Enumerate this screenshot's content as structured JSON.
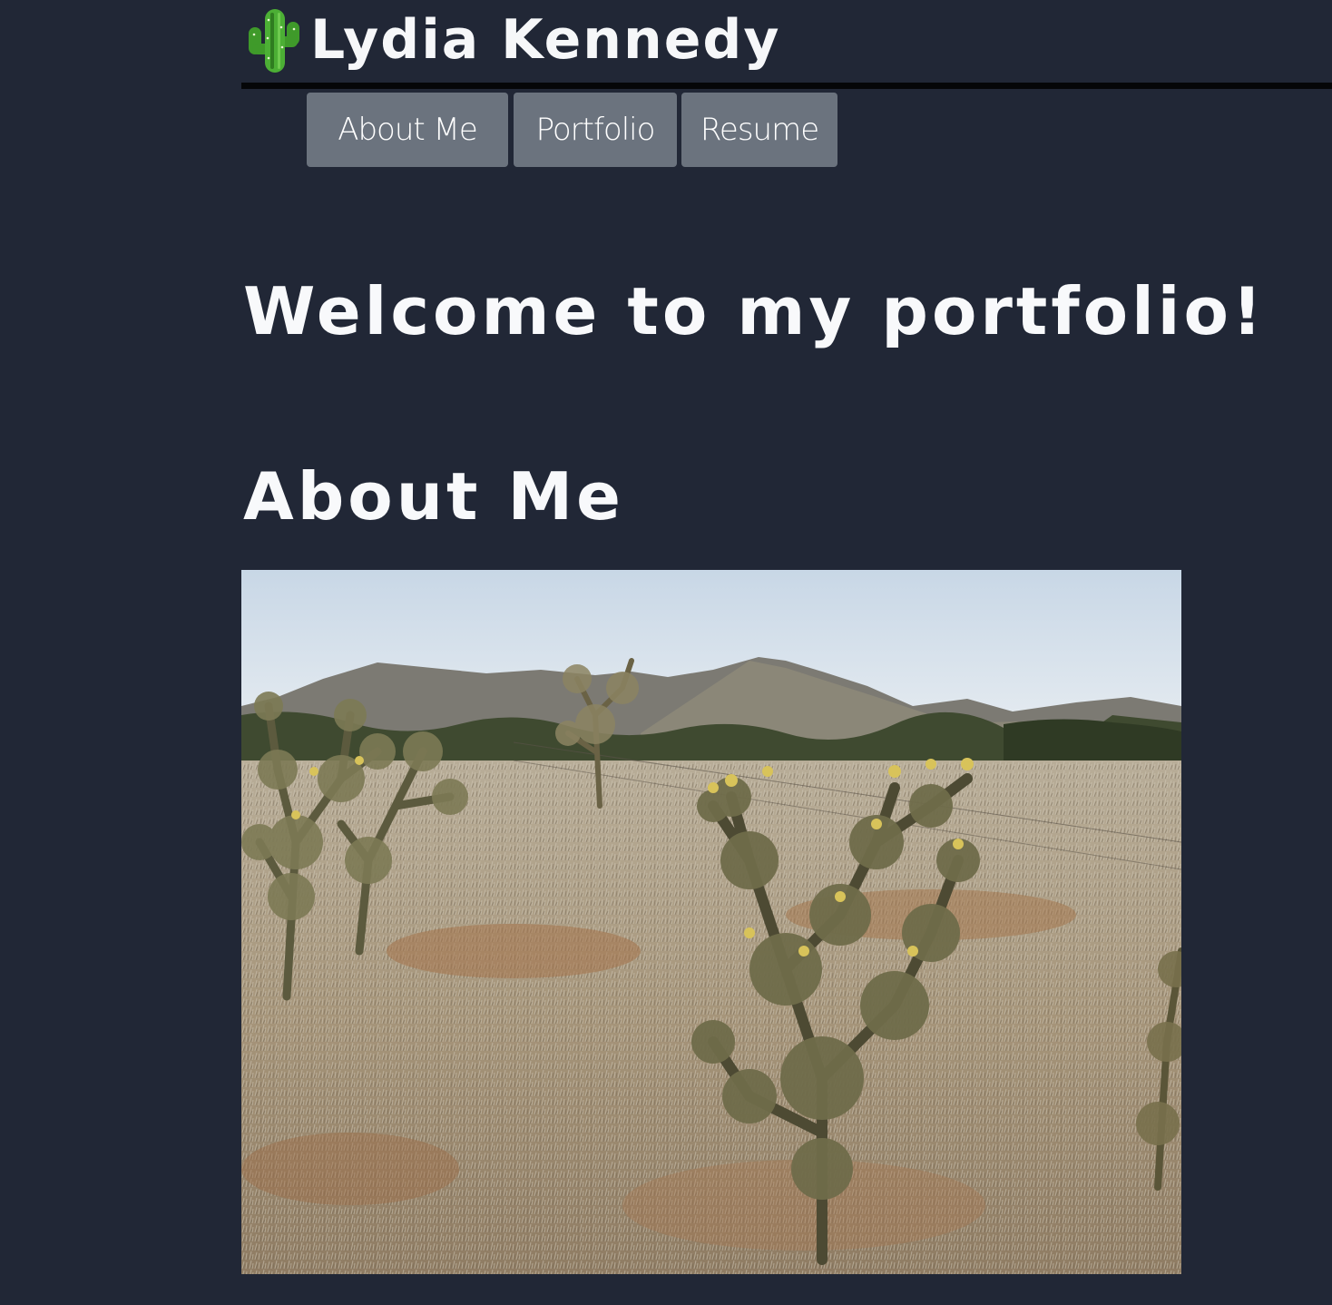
{
  "header": {
    "site_name": "Lydia Kennedy",
    "logo_icon": "cactus-icon"
  },
  "nav": {
    "items": [
      {
        "label": "About Me"
      },
      {
        "label": "Portfolio"
      },
      {
        "label": "Resume"
      }
    ]
  },
  "main": {
    "welcome_heading": "Welcome to my portfolio!",
    "about_heading": "About Me",
    "about_photo": {
      "subject": "desert landscape with cholla cacti and mountains"
    }
  },
  "colors": {
    "page_background": "#212736",
    "nav_button": "#6b737e",
    "header_rule": "#050608",
    "text": "#f8f9fb"
  }
}
